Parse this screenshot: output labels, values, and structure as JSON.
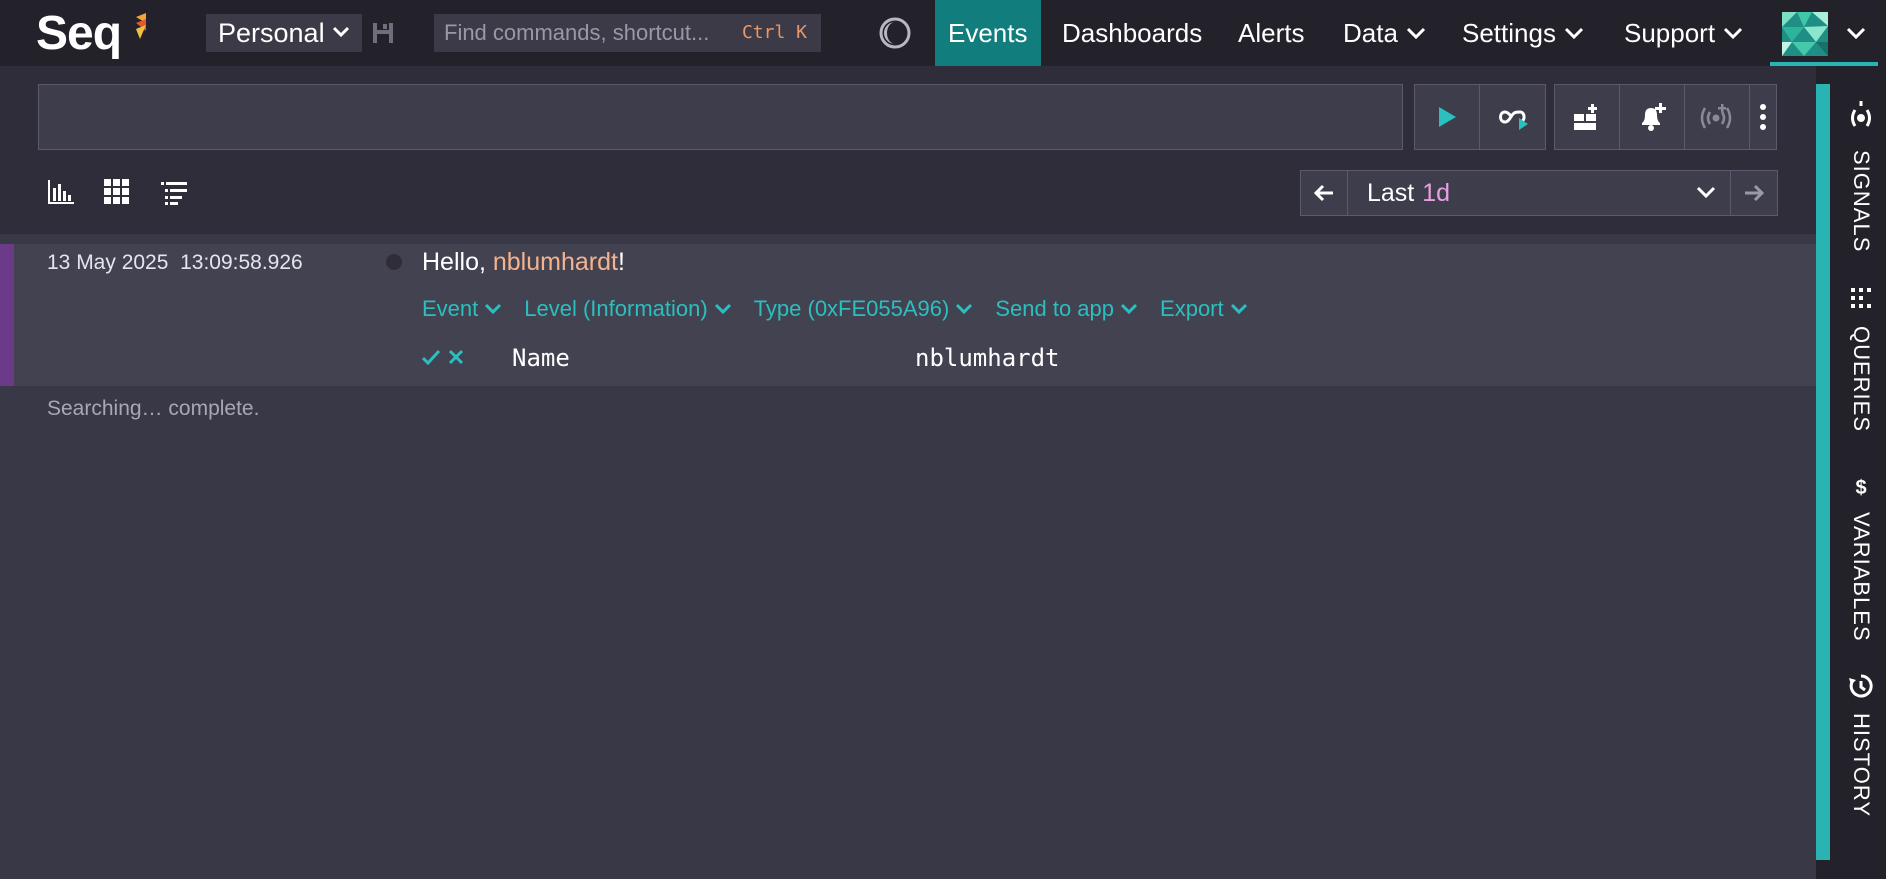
{
  "app": {
    "brand": "Seq"
  },
  "header": {
    "workspace": "Personal",
    "command_search": {
      "placeholder": "Find commands, shortcut...",
      "shortcut": "Ctrl K"
    },
    "nav": [
      {
        "label": "Events",
        "active": true
      },
      {
        "label": "Dashboards"
      },
      {
        "label": "Alerts"
      },
      {
        "label": "Data",
        "dropdown": true
      },
      {
        "label": "Settings",
        "dropdown": true
      },
      {
        "label": "Support",
        "dropdown": true
      }
    ]
  },
  "query": {
    "text": "",
    "time_range": {
      "prefix": "Last",
      "value": "1d"
    }
  },
  "events": [
    {
      "timestamp": "13 May 2025  13:09:58.926",
      "message": {
        "before": "Hello, ",
        "property": "nblumhardt",
        "after": "!"
      },
      "actions": [
        "Event",
        "Level (Information)",
        "Type (0xFE055A96)",
        "Send to app",
        "Export"
      ],
      "properties": [
        {
          "name": "Name",
          "value": "nblumhardt"
        }
      ]
    }
  ],
  "status": "Searching… complete.",
  "rail": [
    "SIGNALS",
    "QUERIES",
    "VARIABLES",
    "HISTORY"
  ],
  "colors": {
    "accent": "#29b3b3",
    "nav_active": "#127d7d",
    "event_stripe": "#6b3a89",
    "property_highlight": "#f4b38f",
    "time_range_accent": "#e9a0e0"
  },
  "icons": [
    "logo-flag-icon",
    "chevron-down-icon",
    "save-icon",
    "theme-toggle-icon",
    "run-query-icon",
    "tail-icon",
    "add-to-dashboard-icon",
    "add-alert-icon",
    "add-signal-icon",
    "more-icon",
    "histogram-icon",
    "grid-icon",
    "list-icon",
    "arrow-left-icon",
    "arrow-right-icon",
    "check-icon",
    "exclude-icon",
    "signals-icon",
    "queries-icon",
    "variables-icon",
    "history-icon"
  ]
}
